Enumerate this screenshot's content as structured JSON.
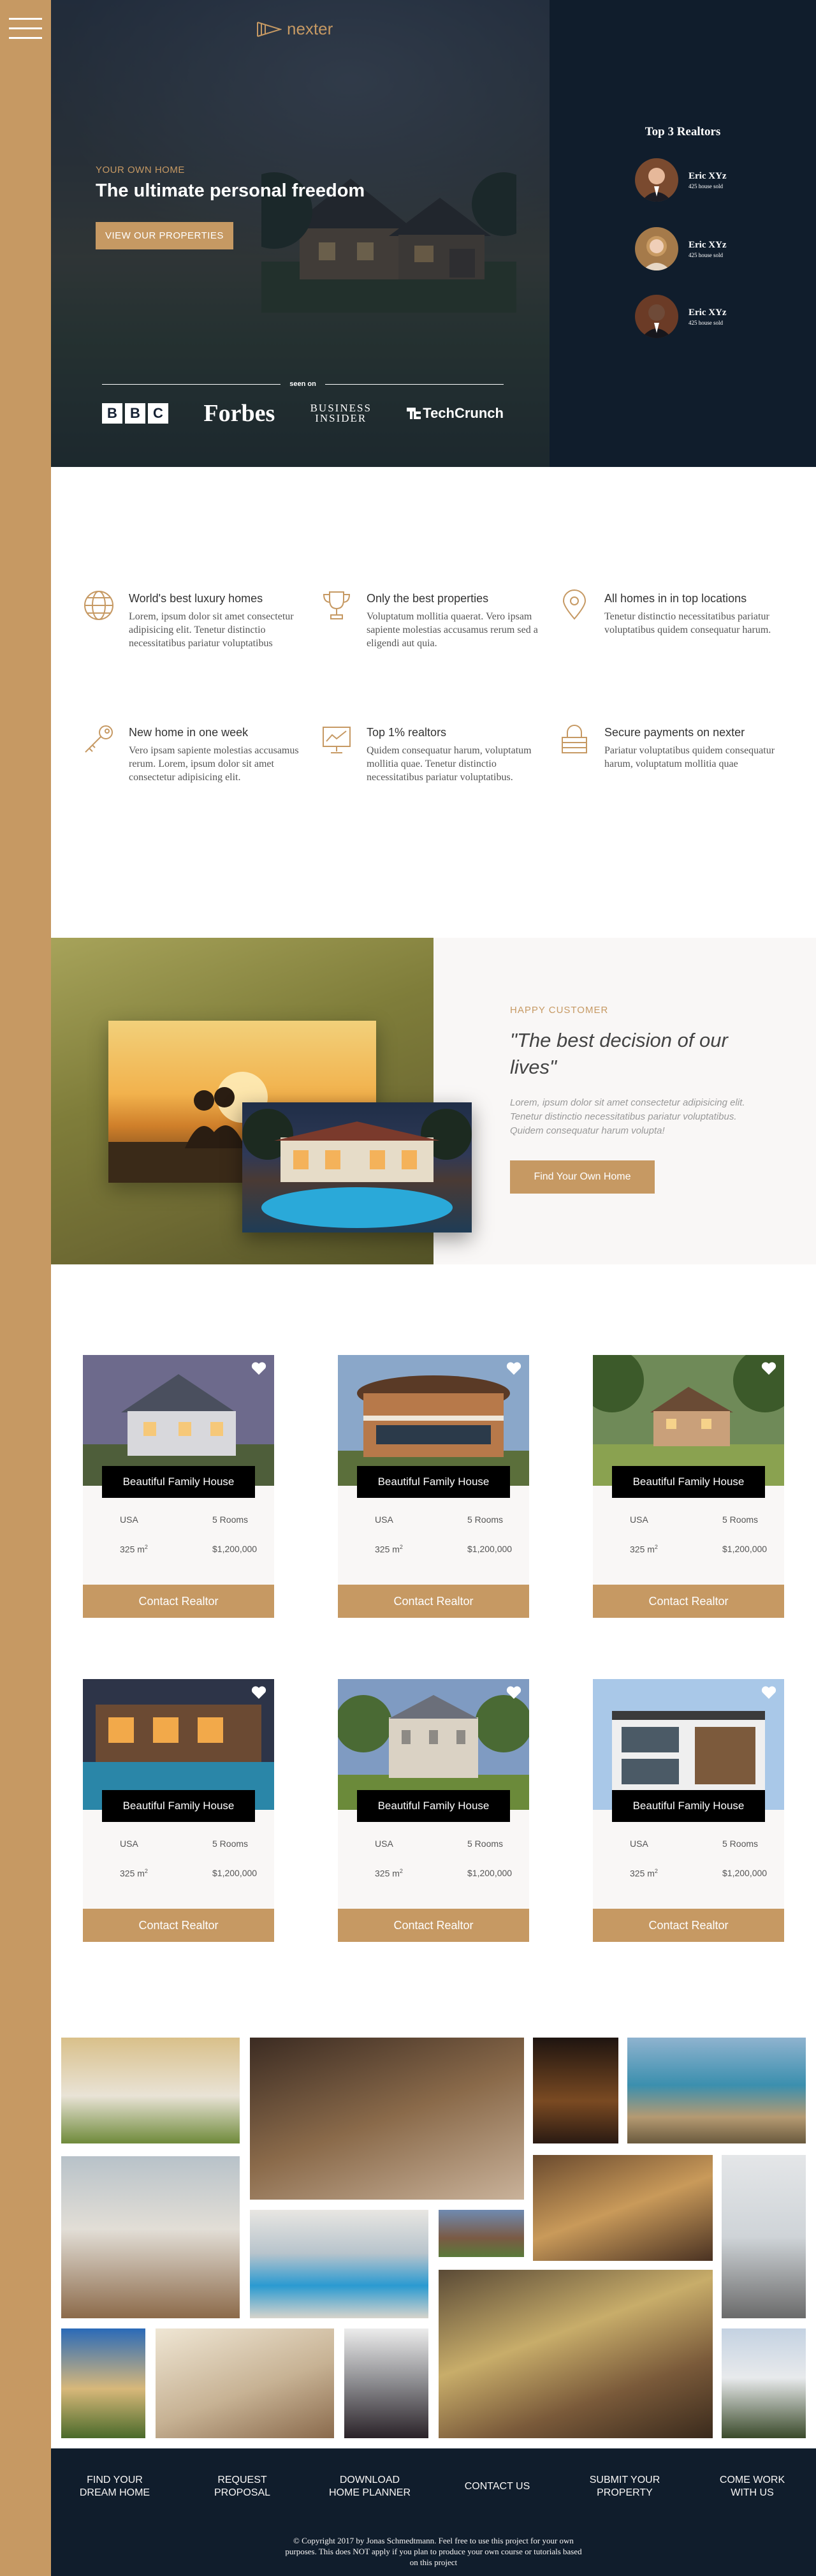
{
  "header": {
    "logo_text": "nexter",
    "subtitle": "Your own home",
    "title": "The ultimate personal freedom",
    "cta_label": "View our properties",
    "seen_on_label": "seen on",
    "brands": {
      "bbc": [
        "B",
        "B",
        "C"
      ],
      "forbes": "Forbes",
      "business_insider_line1": "BUSINESS",
      "business_insider_line2": "INSIDER",
      "techcrunch": "TechCrunch"
    }
  },
  "realtors": {
    "title": "Top 3 Realtors",
    "items": [
      {
        "name": "Eric XYz",
        "sold": "425 house sold"
      },
      {
        "name": "Eric XYz",
        "sold": "425 house sold"
      },
      {
        "name": "Eric XYz",
        "sold": "425 house sold"
      }
    ]
  },
  "features": [
    {
      "icon": "globe-icon",
      "title": "World's best luxury homes",
      "text": "Lorem, ipsum dolor sit amet consectetur adipisicing elit. Tenetur distinctio necessitatibus pariatur voluptatibus"
    },
    {
      "icon": "trophy-icon",
      "title": "Only the best properties",
      "text": "Voluptatum mollitia quaerat. Vero ipsam sapiente molestias accusamus rerum sed a eligendi aut quia."
    },
    {
      "icon": "map-pin-icon",
      "title": "All homes in in top locations",
      "text": "Tenetur distinctio necessitatibus pariatur voluptatibus quidem consequatur harum."
    },
    {
      "icon": "key-icon",
      "title": "New home in one week",
      "text": "Vero ipsam sapiente molestias accusamus rerum. Lorem, ipsum dolor sit amet consectetur adipisicing elit."
    },
    {
      "icon": "chart-icon",
      "title": "Top 1% realtors",
      "text": "Quidem consequatur harum, voluptatum mollitia quae. Tenetur distinctio necessitatibus pariatur voluptatibus."
    },
    {
      "icon": "lock-icon",
      "title": "Secure payments on nexter",
      "text": "Pariatur voluptatibus quidem consequatur harum, voluptatum mollitia quae"
    }
  ],
  "story": {
    "subtitle": "Happy Customer",
    "title": "\"The best decision of our lives\"",
    "text": "Lorem, ipsum dolor sit amet consectetur adipisicing elit. Tenetur distinctio necessitatibus pariatur voluptatibus. Quidem consequatur harum volupta!",
    "button": "Find Your Own Home"
  },
  "homes": [
    {
      "name": "Beautiful Family House",
      "location": "USA",
      "rooms": "5 Rooms",
      "area": "325 m",
      "area_sup": "2",
      "price": "$1,200,000",
      "button": "Contact Realtor"
    },
    {
      "name": "Beautiful Family House",
      "location": "USA",
      "rooms": "5 Rooms",
      "area": "325 m",
      "area_sup": "2",
      "price": "$1,200,000",
      "button": "Contact Realtor"
    },
    {
      "name": "Beautiful Family House",
      "location": "USA",
      "rooms": "5 Rooms",
      "area": "325 m",
      "area_sup": "2",
      "price": "$1,200,000",
      "button": "Contact Realtor"
    },
    {
      "name": "Beautiful Family House",
      "location": "USA",
      "rooms": "5 Rooms",
      "area": "325 m",
      "area_sup": "2",
      "price": "$1,200,000",
      "button": "Contact Realtor"
    },
    {
      "name": "Beautiful Family House",
      "location": "USA",
      "rooms": "5 Rooms",
      "area": "325 m",
      "area_sup": "2",
      "price": "$1,200,000",
      "button": "Contact Realtor"
    },
    {
      "name": "Beautiful Family House",
      "location": "USA",
      "rooms": "5 Rooms",
      "area": "325 m",
      "area_sup": "2",
      "price": "$1,200,000",
      "button": "Contact Realtor"
    }
  ],
  "footer": {
    "nav": [
      {
        "line1": "Find your",
        "line2": "dream home"
      },
      {
        "line1": "Request",
        "line2": "proposal"
      },
      {
        "line1": "Download",
        "line2": "home planner"
      },
      {
        "line1": "Contact us",
        "line2": ""
      },
      {
        "line1": "Submit your",
        "line2": "property"
      },
      {
        "line1": "Come work",
        "line2": "with us"
      }
    ],
    "copyright": "© Copyright 2017 by Jonas Schmedtmann. Feel free to use this project for your own purposes. This does NOT apply if you plan to produce your own course or tutorials based on this project"
  },
  "colors": {
    "primary": "#c69963",
    "dark": "#101d2c",
    "light": "#f9f7f6"
  }
}
